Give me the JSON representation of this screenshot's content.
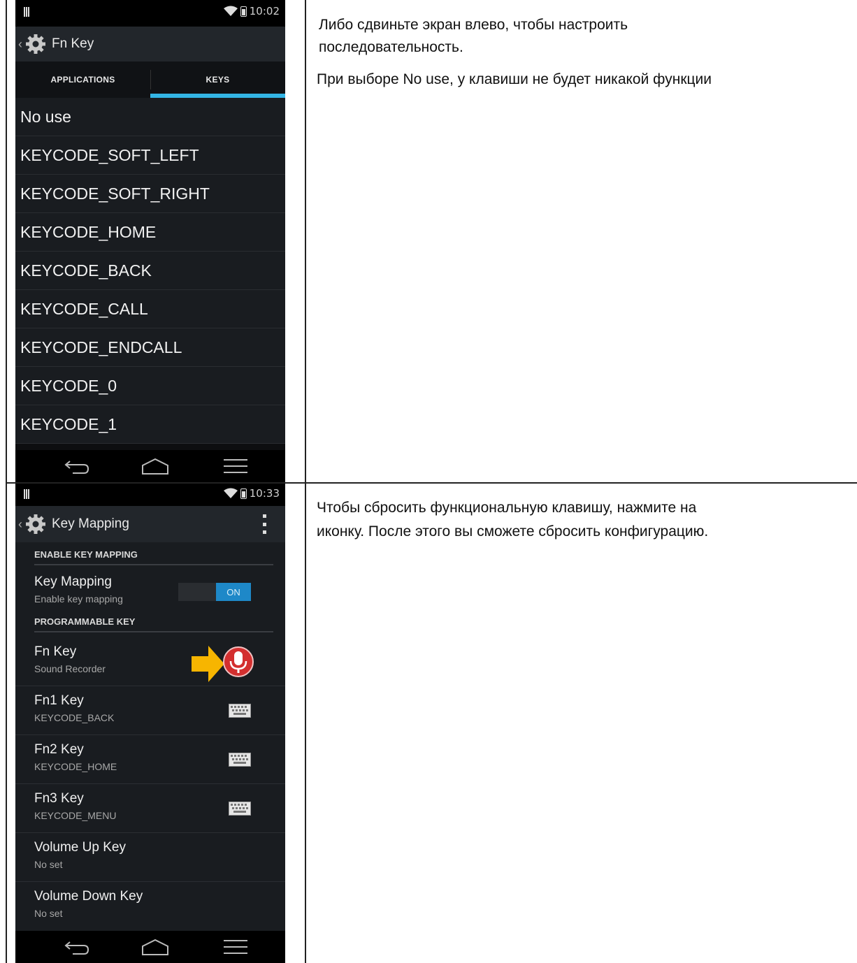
{
  "phone1": {
    "status_time": "10:02",
    "title": "Fn Key",
    "tabs": [
      "APPLICATIONS",
      "KEYS"
    ],
    "keys": [
      "No use",
      "KEYCODE_SOFT_LEFT",
      "KEYCODE_SOFT_RIGHT",
      "KEYCODE_HOME",
      "KEYCODE_BACK",
      "KEYCODE_CALL",
      "KEYCODE_ENDCALL",
      "KEYCODE_0",
      "KEYCODE_1"
    ]
  },
  "phone2": {
    "status_time": "10:33",
    "title": "Key Mapping",
    "section_enable": "ENABLE KEY MAPPING",
    "key_mapping_title": "Key Mapping",
    "key_mapping_sub": "Enable key mapping",
    "toggle_label": "ON",
    "section_programmable": "PROGRAMMABLE KEY",
    "prefs": [
      {
        "title": "Fn Key",
        "sub": "Sound Recorder",
        "icon": "microphone-icon"
      },
      {
        "title": "Fn1 Key",
        "sub": "KEYCODE_BACK",
        "icon": "keyboard-icon"
      },
      {
        "title": "Fn2 Key",
        "sub": "KEYCODE_HOME",
        "icon": "keyboard-icon"
      },
      {
        "title": "Fn3 Key",
        "sub": "KEYCODE_MENU",
        "icon": "keyboard-icon"
      },
      {
        "title": "Volume Up Key",
        "sub": "No set",
        "icon": ""
      },
      {
        "title": "Volume Down Key",
        "sub": "No set",
        "icon": ""
      }
    ]
  },
  "text1": {
    "para1_line1": "Либо сдвиньте экран влево, чтобы настроить",
    "para1_line2": "последовательность.",
    "para2": "При выборе No use, у клавиши не будет никакой функции"
  },
  "text2": {
    "line1": "Чтобы сбросить функциональную клавишу, нажмите на",
    "line2": "иконку. После этого вы сможете сбросить конфигурацию."
  },
  "colors": {
    "tab_indicator": "#33b5e5",
    "toggle_on": "#1e88c8",
    "arrow": "#f7b500",
    "mic": "#d32f2f"
  }
}
